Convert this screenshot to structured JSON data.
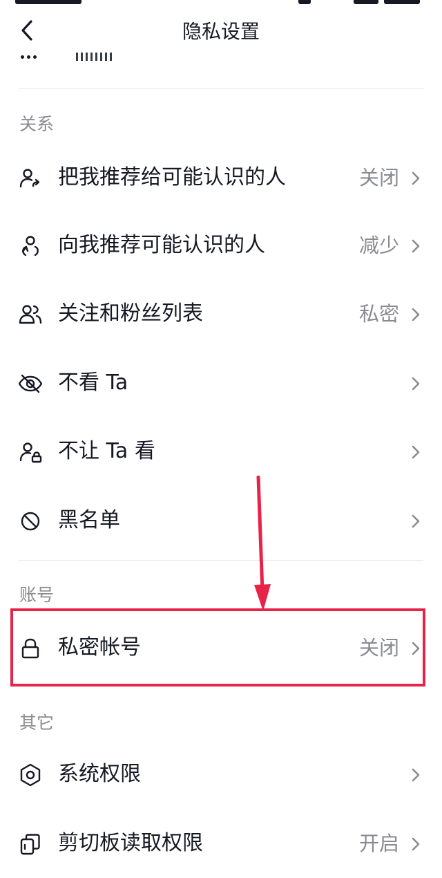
{
  "header": {
    "title": "隐私设置"
  },
  "sections": [
    {
      "title": "关系",
      "items": [
        {
          "label": "把我推荐给可能认识的人",
          "value": "关闭",
          "icon": "person-share-icon"
        },
        {
          "label": "向我推荐可能认识的人",
          "value": "减少",
          "icon": "person-suggest-icon"
        },
        {
          "label": "关注和粉丝列表",
          "value": "私密",
          "icon": "people-icon"
        },
        {
          "label": "不看 Ta",
          "value": "",
          "icon": "eye-off-icon"
        },
        {
          "label": "不让 Ta 看",
          "value": "",
          "icon": "person-lock-icon"
        },
        {
          "label": "黑名单",
          "value": "",
          "icon": "block-icon"
        }
      ]
    },
    {
      "title": "账号",
      "items": [
        {
          "label": "私密帐号",
          "value": "关闭",
          "icon": "lock-icon"
        }
      ]
    },
    {
      "title": "其它",
      "items": [
        {
          "label": "系统权限",
          "value": "",
          "icon": "hexagon-settings-icon"
        },
        {
          "label": "剪切板读取权限",
          "value": "开启",
          "icon": "clipboard-icon"
        }
      ]
    }
  ],
  "annotation": {
    "color": "#e8234a"
  },
  "colors": {
    "text": "#161823",
    "secondary": "#8a8b91",
    "divider": "#e8e8ea"
  }
}
